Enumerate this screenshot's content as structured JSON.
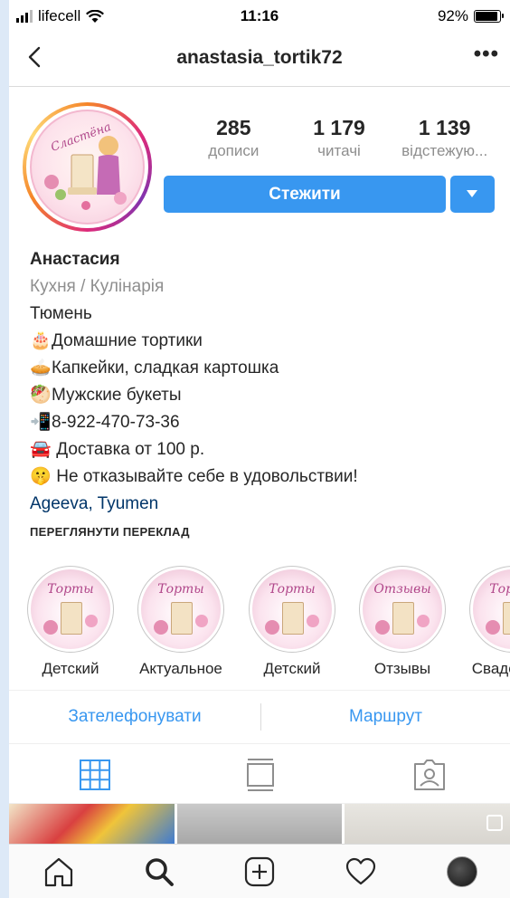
{
  "status_bar": {
    "carrier": "lifecell",
    "time": "11:16",
    "battery": "92%"
  },
  "header": {
    "username": "anastasia_tortik72",
    "more": "•••"
  },
  "profile": {
    "avatar_text": "Сластёна",
    "stats": [
      {
        "value": "285",
        "label": "дописи"
      },
      {
        "value": "1 179",
        "label": "читачі"
      },
      {
        "value": "1 139",
        "label": "відстежую..."
      }
    ],
    "follow_label": "Стежити"
  },
  "bio": {
    "name": "Анастасия",
    "category": "Кухня / Кулінарія",
    "lines": [
      {
        "emoji": "",
        "text": "Тюмень"
      },
      {
        "emoji": "🎂",
        "text": "Домашние тортики"
      },
      {
        "emoji": "🥧",
        "text": "Капкейки, сладкая картошка"
      },
      {
        "emoji": "🥙",
        "text": "Мужские букеты"
      },
      {
        "emoji": "📲",
        "text": "8-922-470-73-36"
      },
      {
        "emoji": "🚘",
        "text": " Доставка от 100 р."
      },
      {
        "emoji": "🤫",
        "text": " Не отказывайте себе в удовольствии!"
      }
    ],
    "location": "Ageeva, Tyumen",
    "translate": "ПЕРЕГЛЯНУТИ ПЕРЕКЛАД"
  },
  "highlights": [
    {
      "label": "Детский",
      "cover_word": "Торты"
    },
    {
      "label": "Актуальное",
      "cover_word": "Торты"
    },
    {
      "label": "Детский",
      "cover_word": "Торты"
    },
    {
      "label": "Отзывы",
      "cover_word": "Отзывы"
    },
    {
      "label": "Свадебные",
      "cover_word": "Торты"
    }
  ],
  "actions": {
    "call": "Зателефонувати",
    "route": "Маршрут"
  },
  "tabs": [
    "grid-icon",
    "feed-icon",
    "tagged-icon"
  ],
  "nav": [
    "home-icon",
    "search-icon",
    "add-post-icon",
    "heart-icon",
    "profile-avatar"
  ],
  "colors": {
    "accent": "#3897f0",
    "text": "#262626",
    "muted": "#8e8e8e",
    "link": "#003569"
  }
}
